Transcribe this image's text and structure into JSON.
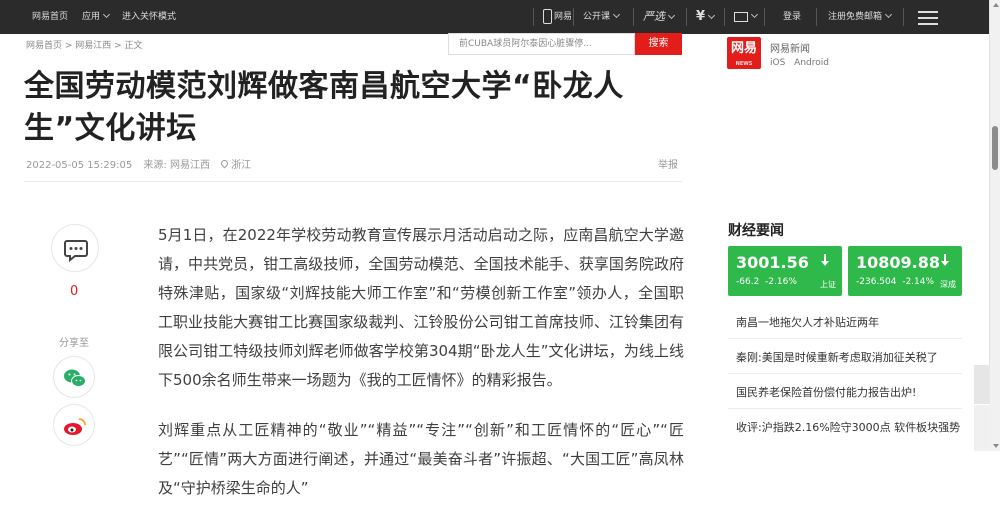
{
  "topbar": {
    "home": "网易首页",
    "apps": "应用",
    "care_mode": "进入关怀模式",
    "mobile": "网易",
    "open_course": "公开课",
    "yanxuan": "严选",
    "money": "¥",
    "mail_icon_label": "",
    "login": "登录",
    "register": "注册免费邮箱"
  },
  "breadcrumb": "网易首页 > 网易江西 > 正文",
  "search": {
    "placeholder": "前CUBA球员阿尔泰因心脏骤停...",
    "button": "搜索"
  },
  "article": {
    "title": "全国劳动模范刘辉做客南昌航空大学“卧龙人生”文化讲坛",
    "date": "2022-05-05 15:29:05",
    "source": "来源: 网易江西",
    "location": "浙江",
    "report": "举报",
    "comment_count": "0",
    "share_label": "分享至",
    "paragraphs": [
      "5月1日，在2022年学校劳动教育宣传展示月活动启动之际，应南昌航空大学邀请，中共党员，钳工高级技师，全国劳动模范、全国技术能手、获享国务院政府特殊津贴，国家级“刘辉技能大师工作室”和“劳模创新工作室”领办人，全国职工职业技能大赛钳工比赛国家级裁判、江铃股份公司钳工首席技师、江铃集团有限公司钳工特级技师刘辉老师做客学校第304期“卧龙人生”文化讲坛，为线上线下500余名师生带来一场题为《我的工匠情怀》的精彩报告。",
      "刘辉重点从工匠精神的“敬业”“精益”“专注”“创新”和工匠情怀的“匠心”“匠艺”“匠情”两大方面进行阐述，并通过“最美奋斗者”许振超、“大国工匠”高凤林及“守护桥梁生命的人”"
    ]
  },
  "sidebar": {
    "app_logo": "网易",
    "app_logo_sub": "NEWS",
    "app_name": "网易新闻",
    "app_os": "iOS Android",
    "finance_title": "财经要闻",
    "stocks": [
      {
        "value": "3001.56",
        "change": "-66.2",
        "percent": "-2.16%",
        "market": "上证",
        "color": "#2fb94a"
      },
      {
        "value": "10809.88",
        "change": "-236.504",
        "percent": "-2.14%",
        "market": "深成",
        "color": "#2fb94a"
      }
    ],
    "news": [
      "南昌一地拖欠人才补贴近两年",
      "秦刚:美国是时候重新考虑取消加征关税了",
      "国民养老保险首份偿付能力报告出炉!",
      "收评:沪指跌2.16%险守3000点 软件板块强势"
    ]
  }
}
